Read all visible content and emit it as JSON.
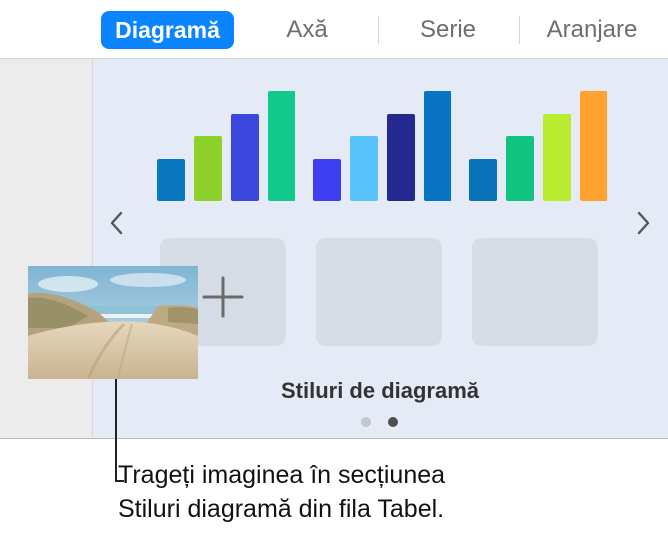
{
  "tabs": [
    {
      "label": "Diagramă",
      "active": true
    },
    {
      "label": "Axă",
      "active": false
    },
    {
      "label": "Serie",
      "active": false
    },
    {
      "label": "Aranjare",
      "active": false
    }
  ],
  "chart_styles": {
    "title": "Stiluri de diagramă",
    "styles": [
      {
        "colors": [
          "#0a78be",
          "#8bd12a",
          "#3b46dd",
          "#11c98a"
        ]
      },
      {
        "colors": [
          "#3f3ff2",
          "#59c3fb",
          "#24298f",
          "#0a74c4"
        ]
      },
      {
        "colors": [
          "#0a72b8",
          "#10c47f",
          "#b9eb2f",
          "#ffa22f"
        ]
      }
    ],
    "placeholders": [
      "add",
      "empty",
      "empty"
    ],
    "page_indicator": {
      "pages": 2,
      "current": 2
    }
  },
  "photo": {
    "subject": "beach-dunes"
  },
  "callout": {
    "line1": "Trageți imaginea în secțiunea",
    "line2": "Stiluri diagramă din fila Tabel."
  },
  "icons": [
    "chevron-left-icon",
    "chevron-right-icon",
    "plus-icon"
  ],
  "colors": {
    "accent": "#0a84ff",
    "panel": "#e4ebf6",
    "sidebar": "#ececec"
  }
}
